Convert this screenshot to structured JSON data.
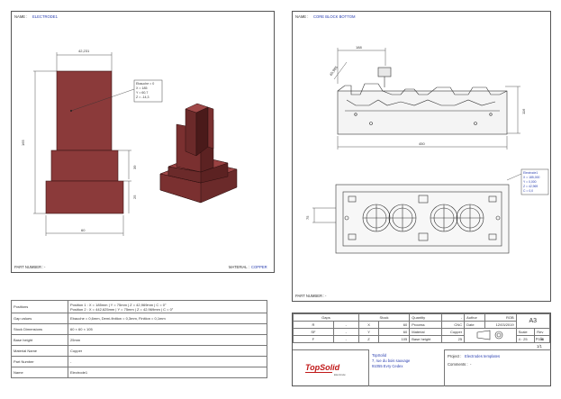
{
  "left_view": {
    "name_label": "NAME :",
    "name_value": "ELECTRODE1",
    "part_number_label": "PART NUMBER :",
    "part_number_value": "-",
    "material_label": "MATERIAL :",
    "material_value": "COPPER",
    "dims": {
      "top_width": "42,231",
      "height": "165",
      "bottom_width": "60",
      "step1": "39",
      "step2": "25"
    },
    "callout": [
      "Ebauche = 0",
      "X = 185",
      "Y = 60,7",
      "Z = -14,3"
    ]
  },
  "right_view": {
    "name_label": "NAME :",
    "name_value": "CORE BLOCK BOTTOM",
    "part_number_label": "PART NUMBER :",
    "part_number_value": "-",
    "dims": {
      "top_offset": "188",
      "angle": "45,985",
      "height": "116",
      "width": "450",
      "left_offset": "75"
    },
    "callout": [
      "Electrode1",
      "X = 185,000",
      "Y = 0,000",
      "Z = 42,969",
      "C = 0,0"
    ]
  },
  "properties_table": [
    {
      "label": "Positions",
      "value": "Position 1 : X = 185mm | Y = 75mm | Z = 42,969mm | C = 0°\nPosition 2 : X = 442,625mm | Y = 75mm | Z = 42,969mm | C = 0°"
    },
    {
      "label": "Gap values",
      "value": "Ebauche = 0,6mm, Demi-finition = 0,3mm, Finition = 0,1mm"
    },
    {
      "label": "Stock Dimensions",
      "value": "60 × 60 × 105"
    },
    {
      "label": "Base height",
      "value": "25mm"
    },
    {
      "label": "Material Name",
      "value": "Copper"
    },
    {
      "label": "Part Number",
      "value": "-"
    },
    {
      "label": "Name",
      "value": "Electrode1"
    }
  ],
  "title_block": {
    "gaps_header": "Gaps",
    "stock_header": "Stock",
    "quantity_label": "Quantity",
    "quantity_value": "-",
    "author_label": "Author",
    "author_value": "ROB",
    "sheet_size": "A3",
    "gaps": [
      {
        "k": "R",
        "v": "-",
        "axis": "X",
        "stock": "60"
      },
      {
        "k": "SF",
        "v": "-",
        "axis": "Y",
        "stock": "60"
      },
      {
        "k": "F",
        "v": "-",
        "axis": "Z",
        "stock": "105"
      }
    ],
    "process_label": "Process",
    "process_value": "CNC",
    "date_label": "Date",
    "date_value": "12/03/2019",
    "material_label": "Material",
    "material_value": "Copper",
    "scale_label": "Scale",
    "scale_value": "4 : 25",
    "rev_label": "Rev",
    "rev_value": "A",
    "folio_label": "Folio",
    "folio_value": "1/1",
    "base_height_label": "Base height",
    "base_height_value": "25",
    "logo_text": "TopSolid",
    "logo_sub": "Electrode",
    "company_lines": [
      "TopSolid",
      "7, rue du bois sauvage",
      "91055 Evry Cedex"
    ],
    "project_label": "Project :",
    "project_value": "Electrodes templates",
    "comments_label": "Comments :",
    "comments_value": "-"
  },
  "colors": {
    "body": "#8b3a3a",
    "body_light": "#a04848",
    "body_dark": "#5c2222",
    "blue_text": "#2a3fb0"
  }
}
